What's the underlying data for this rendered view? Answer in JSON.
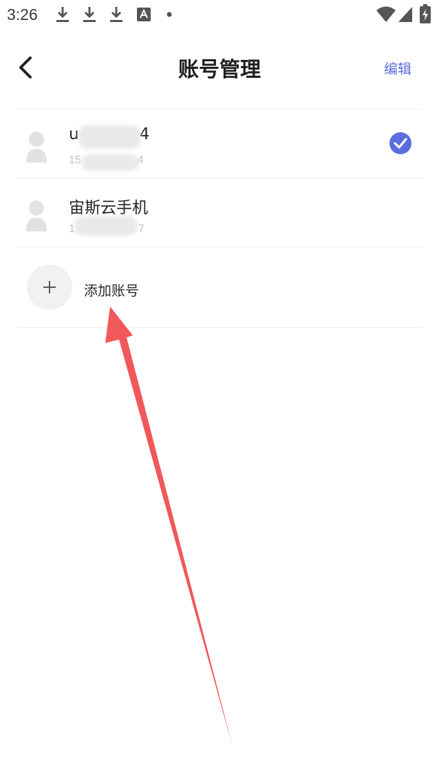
{
  "status_bar": {
    "time": "3:26"
  },
  "header": {
    "title": "账号管理",
    "edit_label": "编辑"
  },
  "accounts": [
    {
      "name_start": "u",
      "name_end": "4",
      "phone_start": "15",
      "phone_end": "4",
      "selected": true
    },
    {
      "name": "宙斯云手机",
      "phone_start": "1",
      "phone_end": "7",
      "selected": false
    }
  ],
  "add_account": {
    "label": "添加账号"
  },
  "colors": {
    "accent": "#5c6de0",
    "annotation_arrow": "#f0585a",
    "avatar_gray": "#e2e2e2"
  }
}
